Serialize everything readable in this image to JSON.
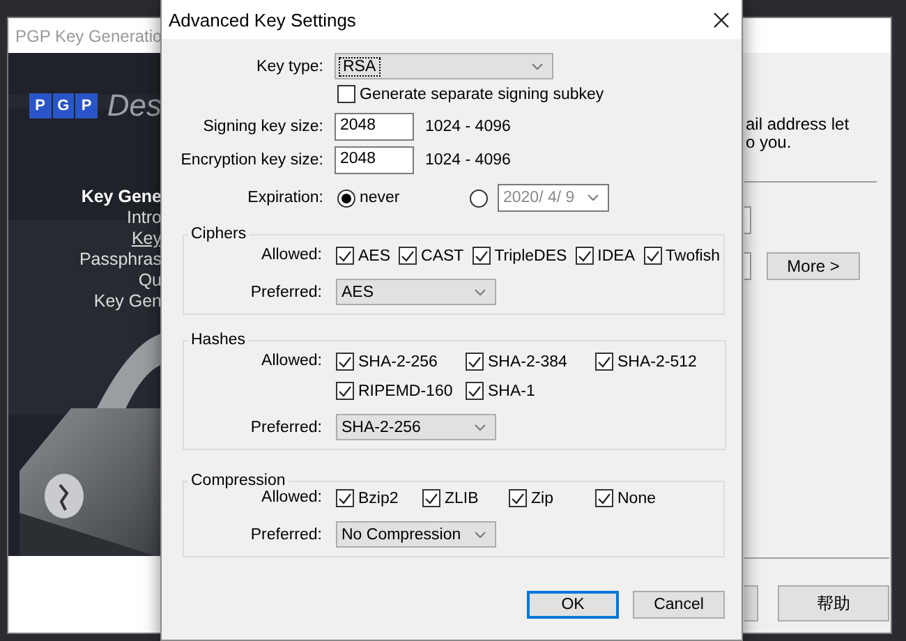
{
  "background_window": {
    "title": "PGP Key Generatio",
    "logo_letters": [
      "P",
      "G",
      "P"
    ],
    "logo_text": "Des",
    "nav_items": [
      {
        "label": "Key Gene",
        "kind": "heading",
        "selected": false
      },
      {
        "label": "Intro",
        "kind": "step",
        "selected": false
      },
      {
        "label": "Key",
        "kind": "step",
        "selected": true
      },
      {
        "label": "Passphras",
        "kind": "step",
        "selected": false
      },
      {
        "label": "Qu",
        "kind": "step",
        "selected": false
      },
      {
        "label": "Key Gen",
        "kind": "step",
        "selected": false
      }
    ],
    "info_lines": [
      "ail address let",
      "o you."
    ],
    "more_button": "More >",
    "help_button": "帮助"
  },
  "dialog": {
    "title": "Advanced Key Settings",
    "key_type": {
      "label": "Key type:",
      "value": "RSA",
      "focused": true
    },
    "subkey": {
      "label": "Generate separate signing subkey",
      "checked": false
    },
    "signing_key_size": {
      "label": "Signing key size:",
      "value": "2048",
      "range": "1024 - 4096"
    },
    "encryption_key_size": {
      "label": "Encryption key size:",
      "value": "2048",
      "range": "1024 - 4096"
    },
    "expiration": {
      "label": "Expiration:",
      "options": [
        {
          "kind": "label",
          "label": "never",
          "selected": true,
          "disabled": false
        },
        {
          "kind": "date",
          "value": "2020/ 4/ 9",
          "selected": false,
          "disabled": true
        }
      ]
    },
    "groups": [
      {
        "title": "Ciphers",
        "allowed_label": "Allowed:",
        "allowed": [
          {
            "label": "AES",
            "checked": true
          },
          {
            "label": "CAST",
            "checked": true
          },
          {
            "label": "TripleDES",
            "checked": true
          },
          {
            "label": "IDEA",
            "checked": true
          },
          {
            "label": "Twofish",
            "checked": true
          }
        ],
        "preferred_label": "Preferred:",
        "preferred": "AES"
      },
      {
        "title": "Hashes",
        "allowed_label": "Allowed:",
        "allowed": [
          {
            "label": "SHA-2-256",
            "checked": true
          },
          {
            "label": "SHA-2-384",
            "checked": true
          },
          {
            "label": "SHA-2-512",
            "checked": true
          },
          {
            "label": "RIPEMD-160",
            "checked": true
          },
          {
            "label": "SHA-1",
            "checked": true
          }
        ],
        "preferred_label": "Preferred:",
        "preferred": "SHA-2-256"
      },
      {
        "title": "Compression",
        "allowed_label": "Allowed:",
        "allowed": [
          {
            "label": "Bzip2",
            "checked": true
          },
          {
            "label": "ZLIB",
            "checked": true
          },
          {
            "label": "Zip",
            "checked": true
          },
          {
            "label": "None",
            "checked": true
          }
        ],
        "preferred_label": "Preferred:",
        "preferred": "No Compression"
      }
    ],
    "buttons": [
      {
        "label": "OK",
        "focused": true
      },
      {
        "label": "Cancel",
        "focused": false
      }
    ]
  }
}
